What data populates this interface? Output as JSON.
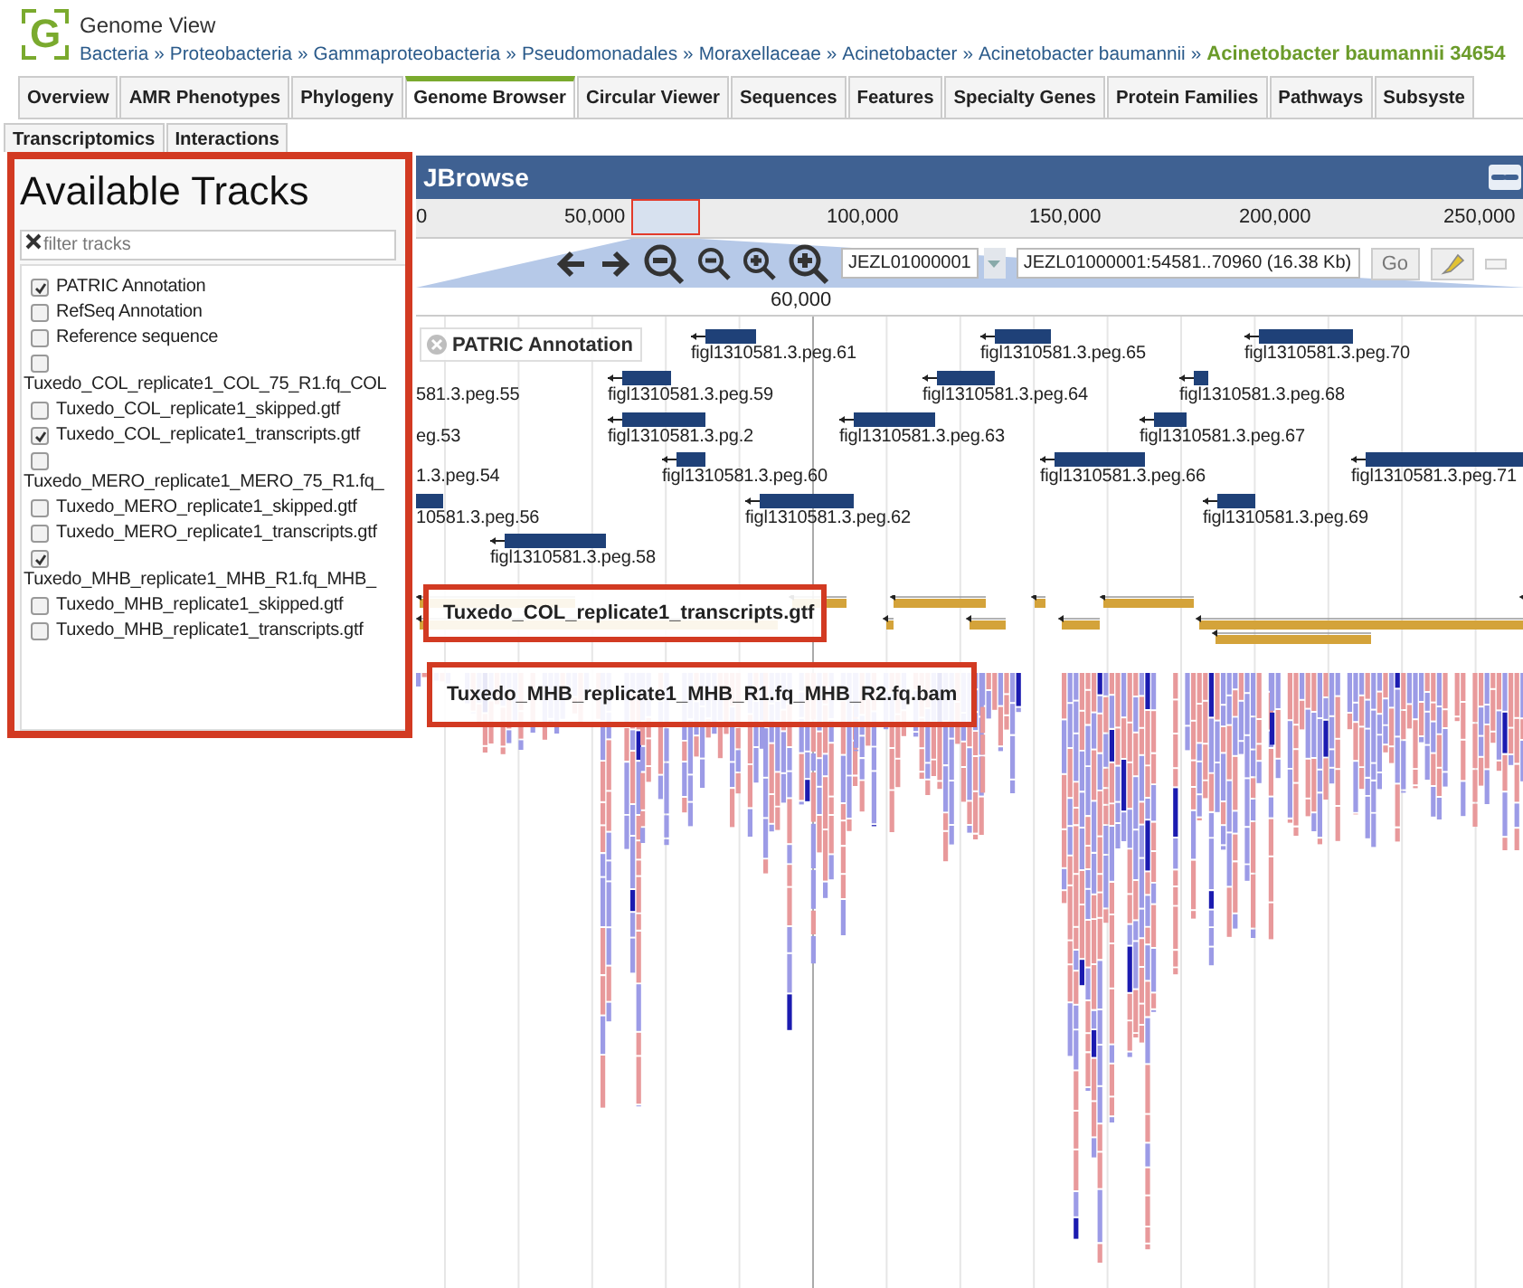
{
  "header": {
    "title": "Genome View",
    "logo_letter": "G",
    "separator": "»",
    "breadcrumb": [
      {
        "label": "Bacteria",
        "current": false
      },
      {
        "label": "Proteobacteria",
        "current": false
      },
      {
        "label": "Gammaproteobacteria",
        "current": false
      },
      {
        "label": "Pseudomonadales",
        "current": false
      },
      {
        "label": "Moraxellaceae",
        "current": false
      },
      {
        "label": "Acinetobacter",
        "current": false
      },
      {
        "label": "Acinetobacter baumannii",
        "current": false
      },
      {
        "label": "Acinetobacter baumannii 34654",
        "current": true
      }
    ]
  },
  "tab_rows": [
    [
      {
        "label": "Overview",
        "selected": false
      },
      {
        "label": "AMR Phenotypes",
        "selected": false
      },
      {
        "label": "Phylogeny",
        "selected": false
      },
      {
        "label": "Genome Browser",
        "selected": true
      },
      {
        "label": "Circular Viewer",
        "selected": false
      },
      {
        "label": "Sequences",
        "selected": false
      },
      {
        "label": "Features",
        "selected": false
      },
      {
        "label": "Specialty Genes",
        "selected": false
      },
      {
        "label": "Protein Families",
        "selected": false
      },
      {
        "label": "Pathways",
        "selected": false
      },
      {
        "label": "Subsyste",
        "selected": false
      }
    ],
    [
      {
        "label": "Transcriptomics",
        "selected": false
      },
      {
        "label": "Interactions",
        "selected": false
      }
    ]
  ],
  "track_panel": {
    "title": "Available Tracks",
    "filter": {
      "placeholder": "filter tracks"
    },
    "tracks": [
      {
        "label": "PATRIC Annotation",
        "checked": true
      },
      {
        "label": "RefSeq Annotation",
        "checked": false
      },
      {
        "label": "Reference sequence",
        "checked": false
      },
      {
        "label": "Tuxedo_COL_replicate1_COL_75_R1.fq_COL",
        "checked": false
      },
      {
        "label": "Tuxedo_COL_replicate1_skipped.gtf",
        "checked": false
      },
      {
        "label": "Tuxedo_COL_replicate1_transcripts.gtf",
        "checked": true
      },
      {
        "label": "Tuxedo_MERO_replicate1_MERO_75_R1.fq_",
        "checked": false
      },
      {
        "label": "Tuxedo_MERO_replicate1_skipped.gtf",
        "checked": false
      },
      {
        "label": "Tuxedo_MERO_replicate1_transcripts.gtf",
        "checked": false
      },
      {
        "label": "Tuxedo_MHB_replicate1_MHB_R1.fq_MHB_",
        "checked": true
      },
      {
        "label": "Tuxedo_MHB_replicate1_skipped.gtf",
        "checked": false
      },
      {
        "label": "Tuxedo_MHB_replicate1_transcripts.gtf",
        "checked": false
      }
    ]
  },
  "browser": {
    "title": "JBrowse",
    "overview_ticks": [
      "0",
      "50,000",
      "100,000",
      "150,000",
      "200,000",
      "250,000"
    ],
    "reference": "JEZL01000001",
    "location": "JEZL01000001:54581..70960 (16.38 Kb)",
    "go": "Go",
    "detail_tick": "60,000",
    "annotation_track": {
      "label": "PATRIC Annotation",
      "features": [
        "figl1310581.3.peg.61",
        "figl1310581.3.peg.65",
        "figl1310581.3.peg.70",
        "581.3.peg.55",
        "figl1310581.3.peg.59",
        "figl1310581.3.peg.64",
        "figl1310581.3.peg.68",
        "eg.53",
        "figl1310581.3.pg.2",
        "figl1310581.3.peg.63",
        "figl1310581.3.peg.67",
        "1.3.peg.54",
        "figl1310581.3.peg.60",
        "figl1310581.3.peg.66",
        "figl1310581.3.peg.71",
        "10581.3.peg.56",
        "figl1310581.3.peg.62",
        "figl1310581.3.peg.69",
        "figl1310581.3.peg.58"
      ]
    },
    "transcripts_track": {
      "label": "Tuxedo_COL_replicate1_transcripts.gtf"
    },
    "alignments_track": {
      "label": "Tuxedo_MHB_replicate1_MHB_R1.fq_MHB_R2.fq.bam"
    }
  }
}
